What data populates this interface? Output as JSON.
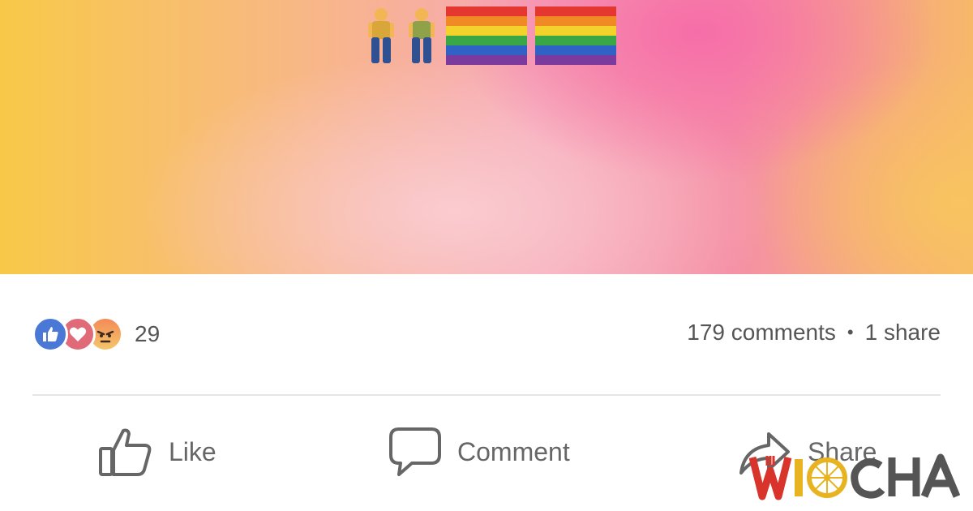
{
  "post": {
    "emoji": [
      "man-icon",
      "man-icon",
      "rainbow-flag-icon",
      "rainbow-flag-icon"
    ]
  },
  "reactions": {
    "icons": [
      "like-reaction-icon",
      "love-reaction-icon",
      "angry-reaction-icon"
    ],
    "count": "29"
  },
  "stats": {
    "comments": "179 comments",
    "separator": "•",
    "shares": "1 share"
  },
  "actions": {
    "like_label": "Like",
    "comment_label": "Comment",
    "share_label": "Share"
  },
  "watermark": {
    "text": "WIOCHA",
    "colors": {
      "red": "#d9342b",
      "yellow": "#e8b321",
      "gray": "#555555"
    }
  },
  "colors": {
    "like_blue": "#4a78d6",
    "love_red": "#e06a78",
    "text_gray": "#555555",
    "action_gray": "#666666"
  }
}
